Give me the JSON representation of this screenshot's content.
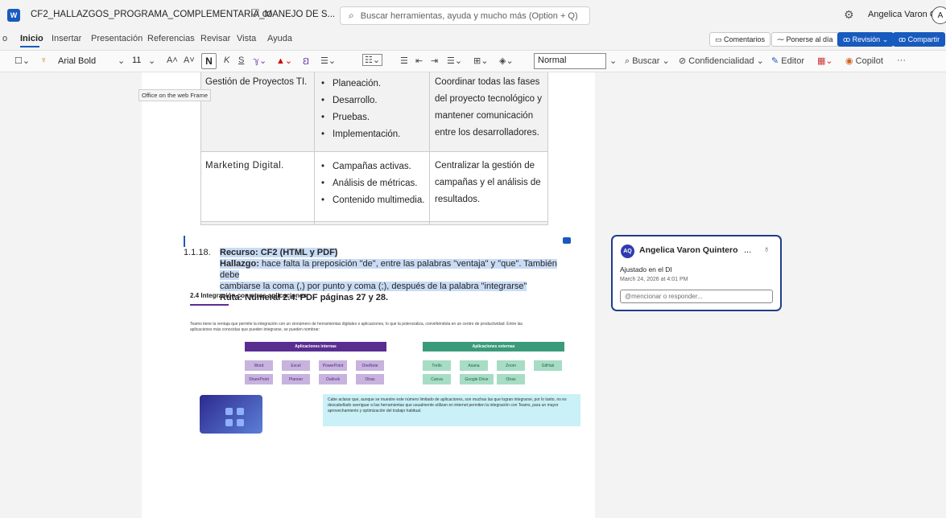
{
  "titlebar": {
    "doc_title": "CF2_HALLAZGOS_PROGRAMA_COMPLEMENTARIA_MANEJO DE S...",
    "search_placeholder": "Buscar herramientas, ayuda y mucho más (Option + Q)",
    "user_name": "Angelica Varon Qu...",
    "avatar_initial": "A"
  },
  "menu": {
    "items": [
      "Inicio",
      "Insertar",
      "Presentación",
      "Referencias",
      "Revisar",
      "Vista",
      "Ayuda"
    ],
    "cut_left": "o",
    "comments": "Comentarios",
    "catch_up": "Ponerse al día",
    "review": "Revisión",
    "share": "Compartir"
  },
  "toolbar": {
    "font": "Arial Bold",
    "size": "11",
    "bold": "N",
    "italic": "K",
    "underline": "S",
    "style": "Normal",
    "find": "Buscar",
    "confidentiality": "Confidencialidad",
    "editor": "Editor",
    "copilot": "Copilot",
    "more": "···"
  },
  "tooltip": "Office on the web Frame",
  "table": {
    "row1": {
      "name": "Gestión de Proyectos TI.",
      "bullets": [
        "Planeación.",
        "Desarrollo.",
        "Pruebas.",
        "Implementación."
      ],
      "desc": [
        "Coordinar todas las fases",
        "del proyecto tecnológico y",
        "mantener comunicación",
        "entre los desarrolladores."
      ]
    },
    "row2": {
      "name": "Marketing Digital.",
      "bullets": [
        "Campañas activas.",
        "Análisis de métricas.",
        "Contenido multimedia."
      ],
      "desc": [
        "Centralizar la gestión de",
        "campañas y el análisis de",
        "resultados."
      ]
    }
  },
  "finding": {
    "number": "1.1.18.",
    "resource": "Recurso: CF2 (HTML y PDF)",
    "finding_label": "Hallazgo:",
    "finding_line1": " hace falta la preposición \"de\", entre las palabras \"ventaja\" y \"que\". También debe",
    "finding_line2": "cambiarse la coma (,) por punto y coma (;), después de la palabra \"integrarse\"",
    "route": "Ruta:  Numeral 2.4. PDF páginas 27 y 28."
  },
  "embed": {
    "title": "2.4 Integración con otras aplicaciones",
    "paragraph": "Teams tiene la ventaja que permite la integración con un sinnúmero de herramientas digitales o aplicaciones, lo que la potencializa, convirtiéndola en un centro de productividad. Entre las aplicaciones más conocidas que pueden integrarse, se pueden nombrar:",
    "internal_header": "Aplicaciones internas",
    "external_header": "Aplicaciones externas",
    "internal_apps": [
      "Word",
      "Excel",
      "PowerPoint",
      "OneNote",
      "SharePoint",
      "Planner",
      "Outlook",
      "Otras"
    ],
    "external_apps": [
      "Trello",
      "Asana",
      "Zoom",
      "GitHub",
      "Canva",
      "Google Drive",
      "Otras"
    ],
    "note": "Cabe aclarar que, aunque se muestre este número limitado de aplicaciones, son muchas las que logran integrarse, por lo tanto, no es descabellado averiguar si las herramientas que usualmente utilizan en internet permiten la integración con Teams, para un mayor aprovechamiento y optimización del trabajo habitual."
  },
  "comment": {
    "initials": "AQ",
    "author": "Angelica Varon Quintero",
    "more": "...",
    "text": "Ajustado en el DI",
    "date": "March 24, 2026 at 4:01 PM",
    "reply_placeholder": "@mencionar o responder..."
  }
}
